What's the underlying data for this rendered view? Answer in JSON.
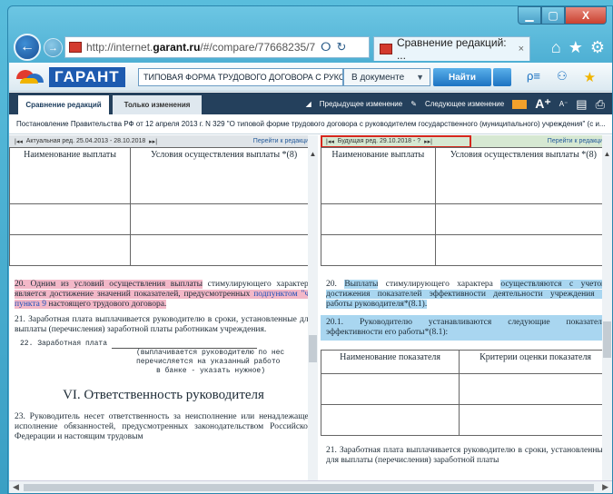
{
  "browser": {
    "address_prefix": "http://internet.",
    "address_domain": "garant.ru",
    "address_rest": "/#/compare/77668235/7035",
    "tab_title": "Сравнение редакций: ...",
    "tab_close": "×",
    "back": "←",
    "forward": "→",
    "search_icon": "ⵔ",
    "refresh_icon": "↻",
    "home_icon": "⌂",
    "star_icon": "★",
    "gear_icon": "⚙"
  },
  "window": {
    "min": "▁",
    "max": "▢",
    "close": "X"
  },
  "garant": {
    "logo_text": "ГАРАНТ",
    "search_value": "ТИПОВАЯ ФОРМА ТРУДОВОГО ДОГОВОРА С РУКОВОДИ",
    "scope": "В документе",
    "find": "Найти"
  },
  "tabs": {
    "compare": "Сравнение редакций",
    "changes": "Только изменения"
  },
  "toolbar": {
    "prev_change": "Предыдущее изменение",
    "next_change": "Следующее изменение",
    "font_up": "A⁺",
    "font_down": "A⁻"
  },
  "doc_title": "Постановление Правительства РФ от 12 апреля 2013 г. N 329 \"О типовой форме трудового договора с руководителем государственного (муниципального) учреждения\" (с и...",
  "left": {
    "header": "Актуальная ред. 25.04.2013 - 28.10.2018",
    "go": "Перейти к редакции",
    "col1": "Наименование выплаты",
    "col2": "Условия осуществления выплаты *(8)",
    "p20_a": "20. Одним из условий осуществления выплаты",
    "p20_b": " стимулирующего характера ",
    "p20_c": "является достижение значений показателей, предусмотренных ",
    "p20_link": "подпунктом \"ч\" пункта 9",
    "p20_d": " настоящего трудового договора.",
    "p21": "21. Заработная плата выплачивается руководителю в сроки, установленные для выплаты (перечисления) заработной платы работникам учреждения.",
    "form_22": "22. Заработная плата",
    "form_note1": "(выплачивается руководителю по нес",
    "form_note2": "перечисляется на указанный работо",
    "form_note3": "в банке - указать нужное)",
    "section": "VI. Ответственность руководителя",
    "p23": "23. Руководитель несет ответственность за неисполнение или ненадлежащее исполнение обязанностей, предусмотренных законодательством Российской Федерации и настоящим трудовым"
  },
  "right": {
    "header": "Будущая ред. 29.10.2018 - ?",
    "go": "Перейти к редакции",
    "col1": "Наименование выплаты",
    "col2": "Условия осуществления выплаты *(8)",
    "p20_a": "20. ",
    "p20_hl1": "Выплаты",
    "p20_b": " стимулирующего характера ",
    "p20_hl2": "осуществляются с учетом достижения показателей эффективности деятельности учреждения и работы руководителя*(8.1).",
    "p201": "20.1. Руководителю устанавливаются следующие показатели эффективности его работы*(8.1):",
    "t2c1": "Наименование показателя",
    "t2c2": "Критерии оценки показателя",
    "p21": "21. Заработная плата выплачивается руководителю в сроки, установленные для выплаты (перечисления) заработной платы"
  }
}
